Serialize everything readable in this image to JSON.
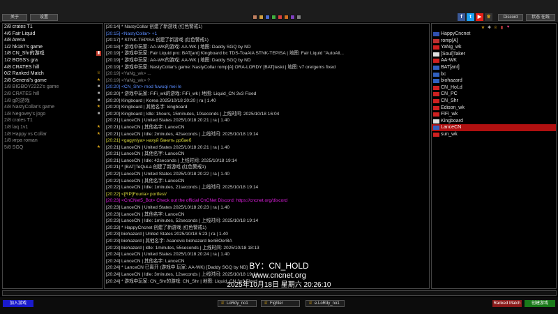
{
  "top": {
    "left_btn": "关于",
    "left_btn2": "设置",
    "right_btn1": "Discord",
    "right_btn2": "状态 在线",
    "swatches": [
      "#c08060",
      "#d0a040",
      "#4a6ad0",
      "#40b040",
      "#d84040",
      "#d07020",
      "#8040c0",
      "#808080"
    ]
  },
  "channels": [
    {
      "name": "2/8 crates T1",
      "state": "active",
      "icon": ""
    },
    {
      "name": "4/6 Fair Liquid",
      "state": "active",
      "icon": ""
    },
    {
      "name": "4/8 Arena",
      "state": "active",
      "icon": ""
    },
    {
      "name": "1/2 hk187's game",
      "state": "active",
      "icon": ""
    },
    {
      "name": "1/8 CN_Shr的游戏",
      "state": "active",
      "icon": "flag-icon"
    },
    {
      "name": "1/2 BOSS's gra",
      "state": "active",
      "icon": ""
    },
    {
      "name": "4/8 CRATES hill",
      "state": "active",
      "icon": ""
    },
    {
      "name": "0/2 Ranked Match",
      "state": "active",
      "icon": "trophy-icon"
    },
    {
      "name": "2/8 General's game",
      "state": "active",
      "icon": "star-icon"
    },
    {
      "name": "1/8 BIGBOY2222's game",
      "state": "inactive",
      "icon": "lock-icon"
    },
    {
      "name": "2/8 CRATES hill",
      "state": "inactive",
      "icon": "lock-icon"
    },
    {
      "name": "1/8 g的游戏",
      "state": "inactive",
      "icon": "lock-icon"
    },
    {
      "name": "4/8 NastyCollar's game",
      "state": "inactive",
      "icon": "star-icon"
    },
    {
      "name": "1/8 Negovey's jogo",
      "state": "inactive",
      "icon": "lock-icon"
    },
    {
      "name": "2/8 crates T1",
      "state": "inactive",
      "icon": ""
    },
    {
      "name": "1/8 laq 1v1",
      "state": "inactive",
      "icon": "star-icon"
    },
    {
      "name": "1/8 Happy vs Collar",
      "state": "inactive",
      "icon": "star-icon"
    },
    {
      "name": "1/8 игра roman",
      "state": "inactive",
      "icon": ""
    },
    {
      "name": "5/8 SGQ",
      "state": "inactive",
      "icon": "star-icon"
    }
  ],
  "chat": [
    {
      "text": "[20:14] * NastyCollar 创建了新游戏 (红色警戒1)",
      "color": "default"
    },
    {
      "text": "[20:15] <NastyCollar> +1",
      "color": "blue"
    },
    {
      "text": "[20:17] * STNK-TEPISA 创建了新游戏 (红色警戒1)",
      "color": "default"
    },
    {
      "text": "[20:18] * 游戏中玩家: AA-WK的游戏: AA-WK | 地图: Daddy SGQ by ND",
      "color": "default"
    },
    {
      "text": "[20:19] * 游戏中玩家: Fair Liquid pro: BAT[ant] Kingboard bc TDS-ToaAIA STNK-TEPISA | 地图: Fair Liquid \"AutoAll...",
      "color": "default"
    },
    {
      "text": "[20:19] * 游戏中玩家: AA-WK的游戏: AA-WK | 地图: Daddy SGQ by ND",
      "color": "default"
    },
    {
      "text": "[20:19] * 游戏中玩家: NastyCollar's game: NastyCollar romp[A] ORA-LORDY [BAT]teski | 地图: v7 ore/gems fixed",
      "color": "default"
    },
    {
      "text": "[20:19] <YaNg_wk> ...",
      "color": "gray"
    },
    {
      "text": "[20:19] <YaNg_wk> ?",
      "color": "gray"
    },
    {
      "text": "[20:20] <CN_Shr> mod fuwuqi mei le",
      "color": "blue"
    },
    {
      "text": "[20:20] * 游戏中玩家: FiFi_wk的游戏: FiFi_wk | 地图: Liquid_CN 3v3 Fixed",
      "color": "default"
    },
    {
      "text": "[20:20] Kingboard | Korea 2025/10/18 20:20 | ra | 1.40",
      "color": "default"
    },
    {
      "text": "[20:20] Kingboard | 其他名字: kingboard",
      "color": "default"
    },
    {
      "text": "[20:20] Kingboard | Idle: 1hours, 15minutes, 10seconds | 上线时间: 2025/10/18 16:04",
      "color": "default"
    },
    {
      "text": "[20:21] LanceCN | United States 2025/10/18 20:21 | ra | 1.40",
      "color": "default"
    },
    {
      "text": "[20:21] LanceCN | 其他名字: LanceCN",
      "color": "default"
    },
    {
      "text": "[20:21] LanceCN | Idle: 2minutes, 42seconds | 上线时间: 2025/10/18 19:14",
      "color": "default"
    },
    {
      "text": "[20:21] <gagyniya> нахуй банить добаеб",
      "color": "yellow"
    },
    {
      "text": "[20:21] LanceCN | United States 2025/10/18 20:21 | ra | 1.40",
      "color": "default"
    },
    {
      "text": "[20:21] LanceCN | 其他名字: LanceCN",
      "color": "default"
    },
    {
      "text": "[20:21] LanceCN | Idle: 42seconds | 上线时间: 2025/10/18 19:14",
      "color": "default"
    },
    {
      "text": "[20:21] * [BAT]TeQuLa 创建了新游戏 (红色警戒1)",
      "color": "default"
    },
    {
      "text": "[20:22] LanceCN | United States 2025/10/18 20:22 | ra | 1.40",
      "color": "default"
    },
    {
      "text": "[20:22] LanceCN | 其他名字: LanceCN",
      "color": "default"
    },
    {
      "text": "[20:22] LanceCN | Idle: 1minutes, 21seconds | 上线时间: 2025/10/18 19:14",
      "color": "default"
    },
    {
      "text": "[20:22] <[RP]Fouria> portfest/",
      "color": "yellow"
    },
    {
      "text": "[20:23] <CnCNet5_Bot> Check out the official CnCNet Discord: https://cncnet.org/discord",
      "color": "magenta"
    },
    {
      "text": "[20:23] LanceCN | United States 2025/10/18 20:23 | ra | 1.40",
      "color": "default"
    },
    {
      "text": "[20:23] LanceCN | 其他名字: LanceCN",
      "color": "default"
    },
    {
      "text": "[20:23] LanceCN | Idle: 1minutes, 52seconds | 上线时间: 2025/10/18 19:14",
      "color": "default"
    },
    {
      "text": "[20:23] * HappyCncnet 创建了新游戏 (红色警戒1)",
      "color": "default"
    },
    {
      "text": "[20:23] biohazard | United States 2025/10/18 5:23 | ra | 1.40",
      "color": "default"
    },
    {
      "text": "[20:23] biohazard | 其他名字: Asanovic biohazard benBOerBA",
      "color": "default"
    },
    {
      "text": "[20:23] biohazard | Idle: 1minutes, 55seconds | 上线时间: 2025/10/18 18:13",
      "color": "default"
    },
    {
      "text": "[20:24] LanceCN | United States 2025/10/18 20:24 | ra | 1.40",
      "color": "default"
    },
    {
      "text": "[20:24] LanceCN | 其他名字: LanceCN",
      "color": "default"
    },
    {
      "text": "[20:24] * LanceCN 已离开 (游戏中 玩家: AA-WK) [Daddy SGQ by ND]",
      "color": "default"
    },
    {
      "text": "[20:24] LanceCN | Idle: 3minutes, 12seconds | 上线时间: 2025/10/18 19:14",
      "color": "default"
    },
    {
      "text": "[20:24] * 游戏中玩家: CN_Shr的游戏: CN_Shr | 地图: Liquid_CN 3v3 Fixed",
      "color": "default"
    }
  ],
  "watermark": {
    "by": "BY：CN_HOLD",
    "url": "www.cncnet.org",
    "datetime": "2025年10月18日 星期六 20:26:10"
  },
  "users": [
    {
      "name": "HappyCncnet",
      "flag": "#3050b0",
      "highlight": false
    },
    {
      "name": "romp[A]",
      "flag": "#c03030",
      "highlight": false
    },
    {
      "name": "YaNg_wk",
      "flag": "#d02020",
      "highlight": false
    },
    {
      "name": "[Soul]Taker",
      "flag": "#e0e0e0",
      "highlight": false
    },
    {
      "name": "AA-WK",
      "flag": "#d02020",
      "highlight": false
    },
    {
      "name": "BAT[ant]",
      "flag": "#3060c0",
      "highlight": false
    },
    {
      "name": "bc",
      "flag": "#3060c0",
      "highlight": false
    },
    {
      "name": "biohazard",
      "flag": "#3060c0",
      "highlight": false
    },
    {
      "name": "CN_HoLd",
      "flag": "#d02020",
      "highlight": false
    },
    {
      "name": "CN_PC",
      "flag": "#d02020",
      "highlight": false
    },
    {
      "name": "CN_Shr",
      "flag": "#d02020",
      "highlight": false
    },
    {
      "name": "Edison_wk",
      "flag": "#d02020",
      "highlight": false
    },
    {
      "name": "FiFi_wk",
      "flag": "#d02020",
      "highlight": false
    },
    {
      "name": "Kingboard",
      "flag": "#e0e0e0",
      "highlight": false
    },
    {
      "name": "LanceCN",
      "flag": "#3060c0",
      "highlight": true
    },
    {
      "name": "sun_wk",
      "flag": "#d02020",
      "highlight": false
    }
  ],
  "bottom": {
    "join_btn": "加入游戏",
    "ranked_btn": "Ranked Match",
    "create_btn": "创建游戏",
    "games": [
      {
        "label": "LoRdy_no1",
        "icon": "trophy-icon"
      },
      {
        "label": "Fighter",
        "icon": "trophy-icon"
      },
      {
        "label": "e.LoRdy_no1",
        "icon": "trophy-icon"
      }
    ]
  }
}
